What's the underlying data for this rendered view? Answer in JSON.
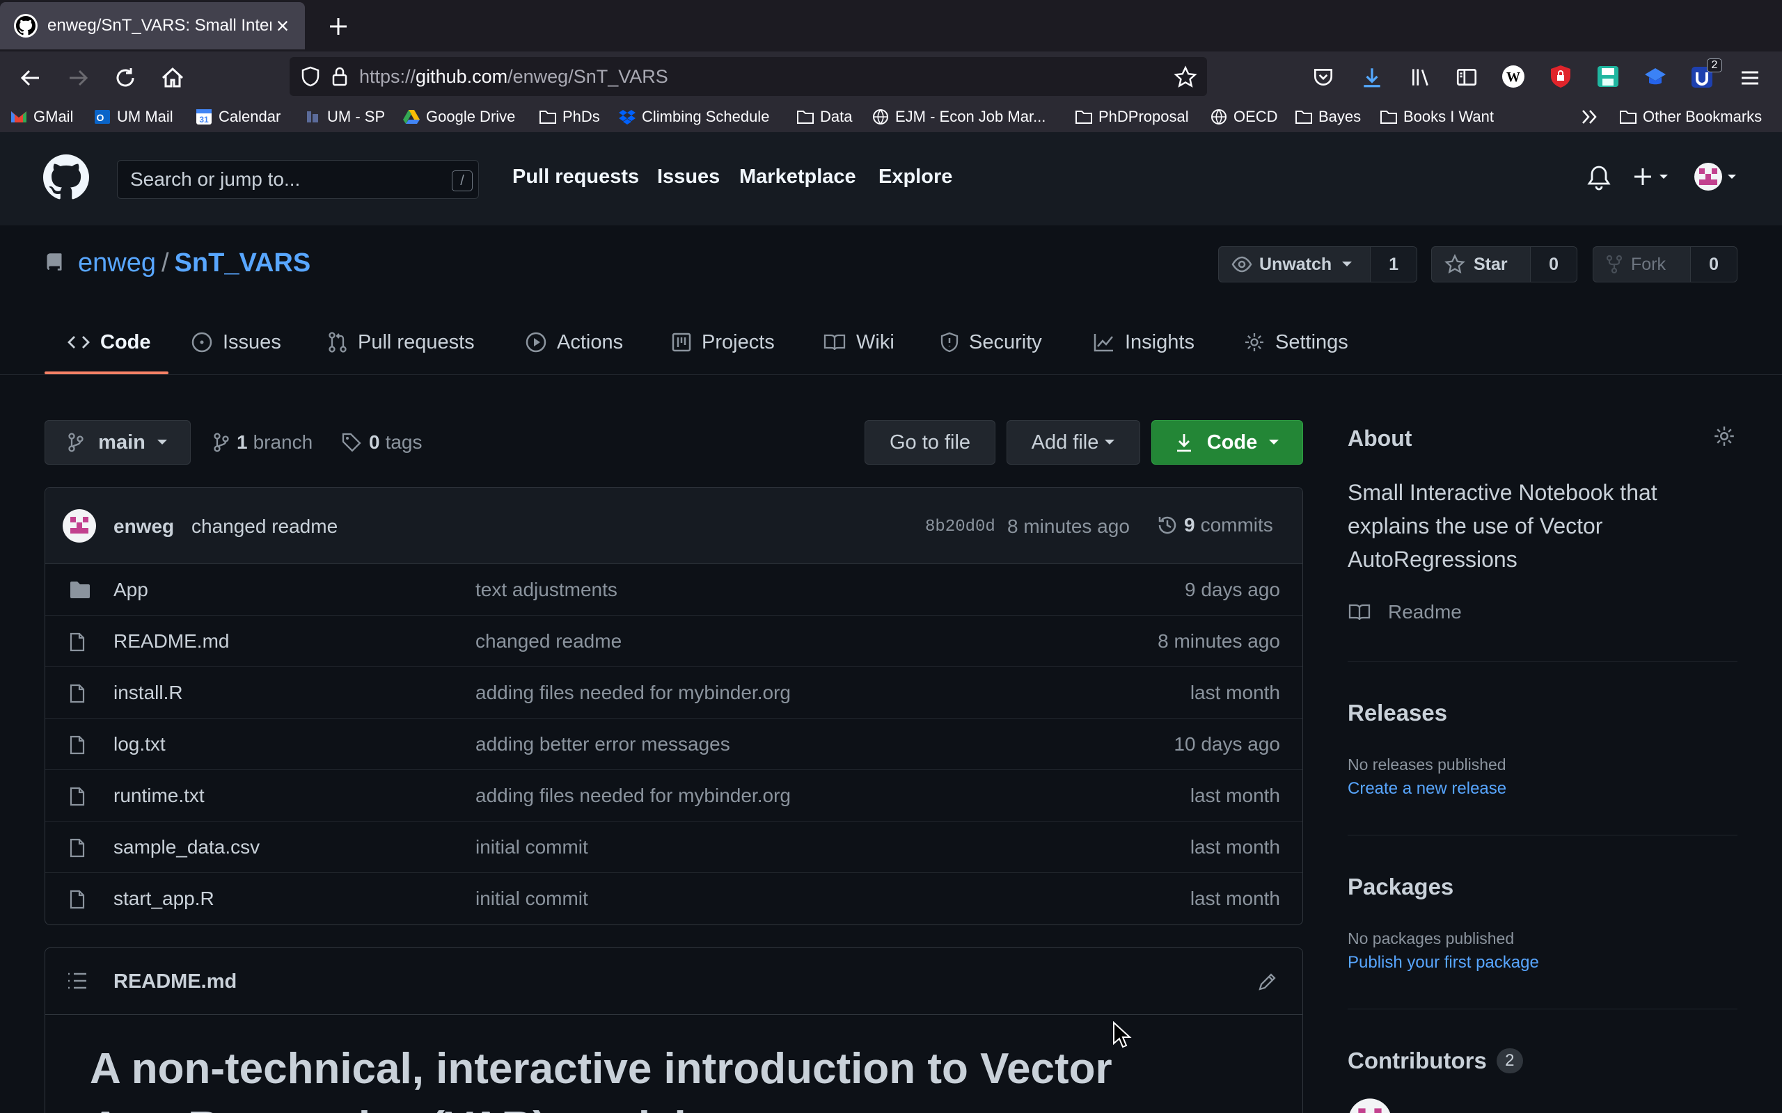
{
  "browser": {
    "tab_title": "enweg/SnT_VARS: Small Interact",
    "url_prefix": "https://",
    "url_host": "github.com",
    "url_path": "/enweg/SnT_VARS",
    "ext_badge": "2",
    "bookmarks": [
      "GMail",
      "UM Mail",
      "Calendar",
      "UM - SP",
      "Google Drive",
      "PhDs",
      "Climbing Schedule",
      "Data",
      "EJM - Econ Job Mar...",
      "PhDProposal",
      "OECD",
      "Bayes",
      "Books I Want"
    ],
    "other_bookmarks": "Other Bookmarks"
  },
  "gh": {
    "search_placeholder": "Search or jump to...",
    "search_key": "/",
    "nav": [
      "Pull requests",
      "Issues",
      "Marketplace",
      "Explore"
    ]
  },
  "repo": {
    "owner": "enweg",
    "sep": "/",
    "name": "SnT_VARS",
    "unwatch_label": "Unwatch",
    "watch_count": "1",
    "star_label": "Star",
    "star_count": "0",
    "fork_label": "Fork",
    "fork_count": "0",
    "tabs": [
      "Code",
      "Issues",
      "Pull requests",
      "Actions",
      "Projects",
      "Wiki",
      "Security",
      "Insights",
      "Settings"
    ]
  },
  "files": {
    "branch": "main",
    "branch_count": "1",
    "branch_label": "branch",
    "tag_count": "0",
    "tag_label": "tags",
    "goto_label": "Go to file",
    "add_label": "Add file",
    "code_label": "Code",
    "last_commit": {
      "author": "enweg",
      "message": "changed readme",
      "sha": "8b20d0d",
      "time": "8 minutes ago",
      "commit_count": "9",
      "commits_label": "commits"
    },
    "rows": [
      {
        "name": "App",
        "type": "dir",
        "msg": "text adjustments",
        "age": "9 days ago"
      },
      {
        "name": "README.md",
        "type": "file",
        "msg": "changed readme",
        "age": "8 minutes ago"
      },
      {
        "name": "install.R",
        "type": "file",
        "msg": "adding files needed for mybinder.org",
        "age": "last month"
      },
      {
        "name": "log.txt",
        "type": "file",
        "msg": "adding better error messages",
        "age": "10 days ago"
      },
      {
        "name": "runtime.txt",
        "type": "file",
        "msg": "adding files needed for mybinder.org",
        "age": "last month"
      },
      {
        "name": "sample_data.csv",
        "type": "file",
        "msg": "initial commit",
        "age": "last month"
      },
      {
        "name": "start_app.R",
        "type": "file",
        "msg": "initial commit",
        "age": "last month"
      }
    ]
  },
  "readme": {
    "filename": "README.md",
    "heading": "A non-technical, interactive introduction to Vector",
    "heading_line2": "AutoRegressive (VAR) models"
  },
  "sidebar": {
    "about_title": "About",
    "description": "Small Interactive Notebook that explains the use of Vector AutoRegressions",
    "readme_label": "Readme",
    "releases_title": "Releases",
    "releases_none": "No releases published",
    "releases_link": "Create a new release",
    "packages_title": "Packages",
    "packages_none": "No packages published",
    "packages_link": "Publish your first package",
    "contributors_title": "Contributors",
    "contributors_count": "2"
  },
  "colors": {
    "link": "#58a6ff",
    "primary_button": "#238636",
    "tab_underline": "#f78166"
  }
}
